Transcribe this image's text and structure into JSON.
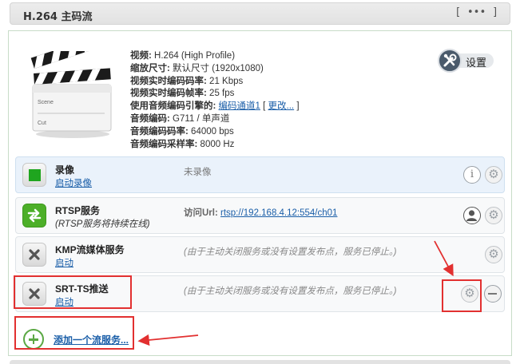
{
  "header": {
    "title": "H.264 主码流",
    "menu_label": "[ ••• ]"
  },
  "stream_info": {
    "video_label": "视频:",
    "video_value": "H.264 (High Profile)",
    "scale_label": "缩放尺寸:",
    "scale_value": "默认尺寸 (1920x1080)",
    "video_bitrate_label": "视频实时编码码率:",
    "video_bitrate_value": "21 Kbps",
    "video_fps_label": "视频实时编码帧率:",
    "video_fps_value": "25 fps",
    "audio_engine_label": "使用音频编码引擎的:",
    "audio_engine_link": "编码通道1",
    "audio_engine_change": "更改...",
    "audio_codec_label": "音频编码:",
    "audio_codec_value": "G711 / 单声道",
    "audio_bitrate_label": "音频编码码率:",
    "audio_bitrate_value": "64000 bps",
    "audio_samplerate_label": "音频编码采样率:",
    "audio_samplerate_value": "8000 Hz",
    "clapper_scene": "Scene",
    "clapper_cut": "Cut"
  },
  "settings_button": {
    "label": "设置",
    "icon": "tools-icon"
  },
  "services": [
    {
      "title": "录像",
      "sub": "启动录像",
      "status": "未录像",
      "icon": "record-icon",
      "color": "#1fa51f"
    },
    {
      "title": "RTSP服务",
      "sub": "(RTSP服务将持续在线)",
      "status_label": "访问Url:",
      "status_url": "rtsp://192.168.4.12:554/ch01",
      "icon": "rtsp-arrows-icon",
      "color": "#4caf28"
    },
    {
      "title": "KMP流媒体服务",
      "sub": "启动",
      "status": "(由于主动关闭服务或没有设置发布点，服务已停止。)",
      "icon": "stopped-x-icon"
    },
    {
      "title": "SRT-TS推送",
      "sub": "启动",
      "status": "(由于主动关闭服务或没有设置发布点，服务已停止。)",
      "icon": "stopped-x-icon"
    }
  ],
  "add_service": {
    "label": "添加一个流服务..."
  },
  "colors": {
    "link": "#1a5ea8",
    "annotation": "#e23030",
    "add_green": "#5ba844"
  }
}
